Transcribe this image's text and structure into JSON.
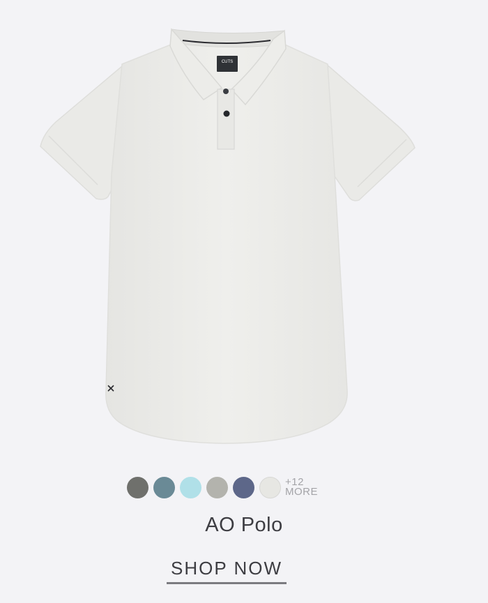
{
  "product": {
    "name": "AO Polo",
    "brand_tag": "CUTS",
    "image_alt": "AO Polo shirt",
    "more_count": "+12",
    "more_label": "MORE",
    "cta_label": "SHOP NOW"
  },
  "swatches": [
    {
      "name": "charcoal",
      "color": "#6f706c"
    },
    {
      "name": "slate-blue",
      "color": "#6a8a96"
    },
    {
      "name": "aqua",
      "color": "#b0e0e8"
    },
    {
      "name": "stone-gray",
      "color": "#b3b3ad"
    },
    {
      "name": "navy",
      "color": "#5d6789"
    },
    {
      "name": "white",
      "color": "#e7e7e3"
    }
  ],
  "colors": {
    "background": "#f3f3f6",
    "shirt": "#ebebe8",
    "text": "#3d3d42",
    "muted_text": "#a4a4a8"
  }
}
